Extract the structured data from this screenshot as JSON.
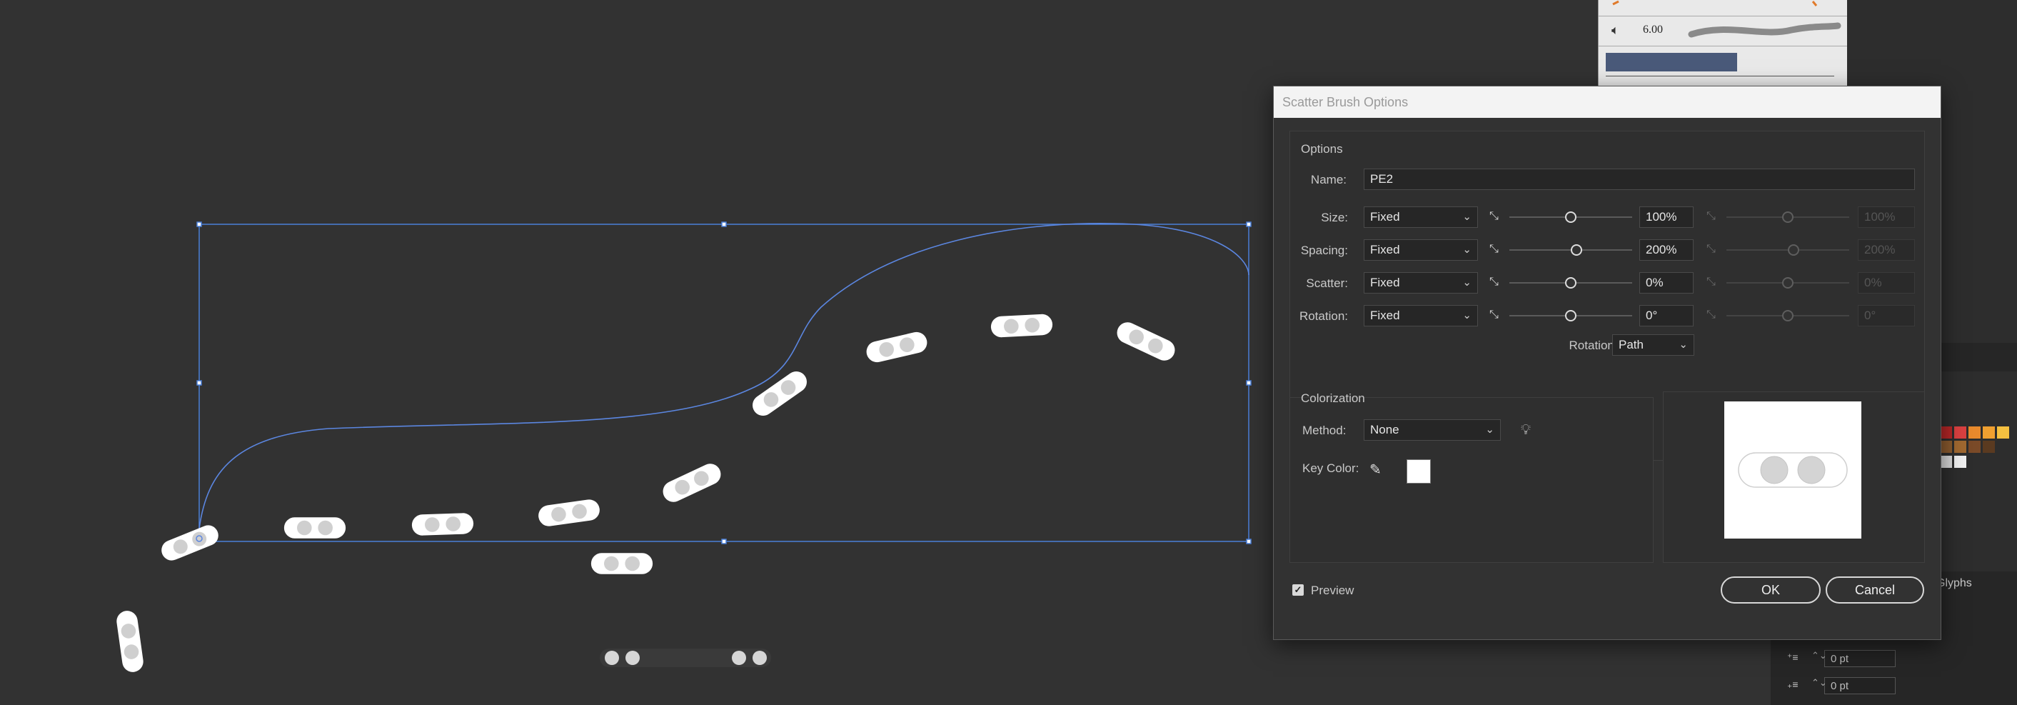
{
  "dialog": {
    "title": "Scatter Brush Options",
    "options_group": "Options",
    "name_label": "Name:",
    "name_value": "PE2",
    "rows": [
      {
        "label": "Size:",
        "method": "Fixed",
        "value": "100%",
        "value2": "100%",
        "slider": 0.5
      },
      {
        "label": "Spacing:",
        "method": "Fixed",
        "value": "200%",
        "value2": "200%",
        "slider": 0.55
      },
      {
        "label": "Scatter:",
        "method": "Fixed",
        "value": "0%",
        "value2": "0%",
        "slider": 0.5
      },
      {
        "label": "Rotation:",
        "method": "Fixed",
        "value": "0°",
        "value2": "0°",
        "slider": 0.5
      }
    ],
    "rotation_relative_label": "Rotation relative to:",
    "rotation_relative_value": "Path",
    "colorization_group": "Colorization",
    "method_label": "Method:",
    "method_value": "None",
    "key_color_label": "Key Color:",
    "key_color": "#ffffff",
    "preview_label": "Preview",
    "preview_checked": true,
    "ok_label": "OK",
    "cancel_label": "Cancel"
  },
  "brushes_panel": {
    "stroke_weight": "6.00"
  },
  "right_panel": {
    "glyphs_tab": "Glyphs",
    "space_before": "0 pt",
    "space_after": "0 pt",
    "swatch_colors": [
      "#b52626",
      "#d94040",
      "#e8892c",
      "#f0a030",
      "#f5c040",
      "#8a5a2e",
      "#a06830",
      "#7a4a28",
      "#5a3a20",
      "#d9d9d9",
      "#f0f0f0"
    ]
  },
  "colors": {
    "canvas": "#323232",
    "selection": "#4a7fd8",
    "dialog_bg": "#323232",
    "title_bar": "#f3f3f3"
  }
}
